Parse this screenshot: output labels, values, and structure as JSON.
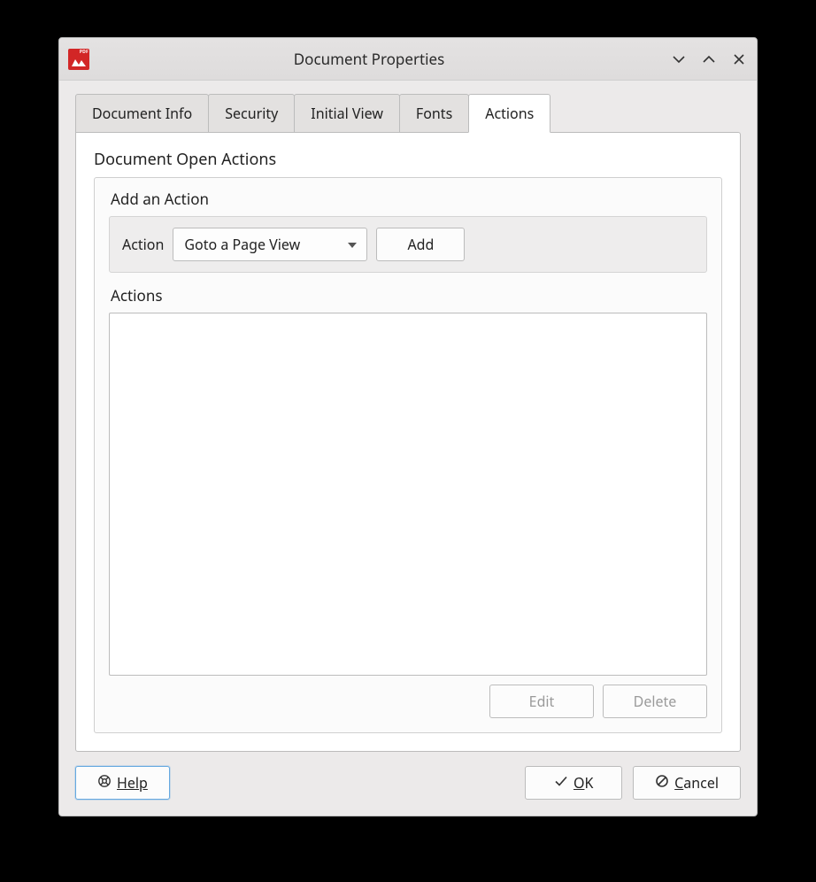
{
  "window": {
    "title": "Document Properties"
  },
  "tabs": {
    "doc_info": "Document Info",
    "security": "Security",
    "initial_view": "Initial View",
    "fonts": "Fonts",
    "actions": "Actions"
  },
  "actions_tab": {
    "section_title": "Document Open Actions",
    "add_title": "Add an Action",
    "action_label": "Action",
    "action_select": "Goto a Page View",
    "add_button": "Add",
    "list_title": "Actions",
    "edit_button": "Edit",
    "delete_button": "Delete"
  },
  "footer": {
    "help": "Help",
    "ok": "OK",
    "cancel": "Cancel"
  }
}
